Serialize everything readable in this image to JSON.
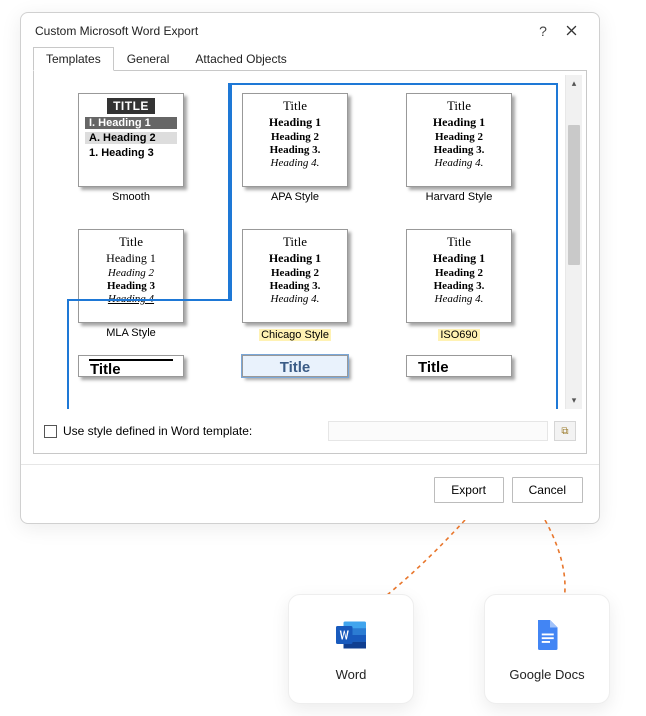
{
  "dialog": {
    "title": "Custom Microsoft Word Export",
    "help": "?",
    "tabs": [
      "Templates",
      "General",
      "Attached Objects"
    ],
    "checkbox_label": "Use style defined in Word template:",
    "buttons": {
      "export": "Export",
      "cancel": "Cancel"
    }
  },
  "templates": {
    "row1": [
      {
        "name": "Smooth",
        "lines": {
          "title": "TITLE",
          "h1": "I. Heading 1",
          "h2": "A. Heading 2",
          "h3": "1. Heading 3"
        }
      },
      {
        "name": "APA Style",
        "lines": {
          "title": "Title",
          "h1": "Heading 1",
          "h2": "Heading 2",
          "h3": "Heading 3.",
          "h4": "Heading 4."
        }
      },
      {
        "name": "Harvard Style",
        "lines": {
          "title": "Title",
          "h1": "Heading 1",
          "h2": "Heading 2",
          "h3": "Heading 3.",
          "h4": "Heading 4."
        }
      }
    ],
    "row2": [
      {
        "name": "MLA Style",
        "lines": {
          "title": "Title",
          "h1": "Heading 1",
          "h2": "Heading 2",
          "h3": "Heading 3",
          "h4": "Heading 4"
        }
      },
      {
        "name": "Chicago Style",
        "lines": {
          "title": "Title",
          "h1": "Heading 1",
          "h2": "Heading 2",
          "h3": "Heading 3.",
          "h4": "Heading 4."
        }
      },
      {
        "name": "ISO690",
        "lines": {
          "title": "Title",
          "h1": "Heading 1",
          "h2": "Heading 2",
          "h3": "Heading 3.",
          "h4": "Heading 4."
        }
      }
    ],
    "row3": [
      {
        "name": "",
        "lines": {
          "title": "Title"
        }
      },
      {
        "name": "",
        "lines": {
          "title": "Title"
        }
      },
      {
        "name": "",
        "lines": {
          "title": "Title"
        }
      }
    ]
  },
  "destinations": {
    "word": "Word",
    "gdocs": "Google Docs"
  }
}
